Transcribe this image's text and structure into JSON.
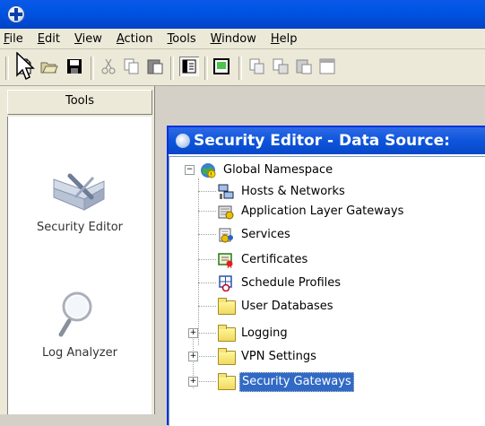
{
  "menu": {
    "items": [
      {
        "label": "File",
        "ul": "F",
        "rest": "ile"
      },
      {
        "label": "Edit",
        "ul": "E",
        "rest": "dit"
      },
      {
        "label": "View",
        "ul": "V",
        "rest": "iew"
      },
      {
        "label": "Action",
        "ul": "A",
        "rest": "ction"
      },
      {
        "label": "Tools",
        "ul": "T",
        "rest": "ools"
      },
      {
        "label": "Window",
        "ul": "W",
        "rest": "indow"
      },
      {
        "label": "Help",
        "ul": "H",
        "rest": "elp"
      }
    ]
  },
  "toolbar": {
    "buttons": [
      "new-icon",
      "open-icon",
      "save-icon",
      "cut-icon",
      "copy-icon",
      "paste-icon",
      "properties-icon",
      "show-hide-icon",
      "copy-to-icon",
      "move-icon",
      "paste-special-icon",
      "new-window-icon"
    ]
  },
  "tools_pane": {
    "header": "Tools",
    "items": [
      {
        "label": "Security Editor",
        "icon": "security-editor-icon"
      },
      {
        "label": "Log Analyzer",
        "icon": "magnifier-icon"
      }
    ]
  },
  "child_window": {
    "title": "Security Editor - Data Source:"
  },
  "tree": {
    "root": "Global Namespace",
    "children": [
      {
        "label": "Hosts & Networks",
        "icon": "hosts-networks-icon"
      },
      {
        "label": "Application Layer Gateways",
        "icon": "gateway-icon"
      },
      {
        "label": "Services",
        "icon": "services-icon"
      },
      {
        "label": "Certificates",
        "icon": "certificate-icon"
      },
      {
        "label": "Schedule Profiles",
        "icon": "schedule-icon"
      },
      {
        "label": "User Databases",
        "icon": "folder-icon"
      },
      {
        "label": "Logging",
        "icon": "folder-icon"
      },
      {
        "label": "VPN Settings",
        "icon": "folder-icon"
      },
      {
        "label": "Security Gateways",
        "icon": "folder-icon",
        "selected": true
      }
    ]
  },
  "colors": {
    "titlebar": "#0054e3",
    "chrome": "#ece9d8",
    "selection": "#316ac5"
  }
}
